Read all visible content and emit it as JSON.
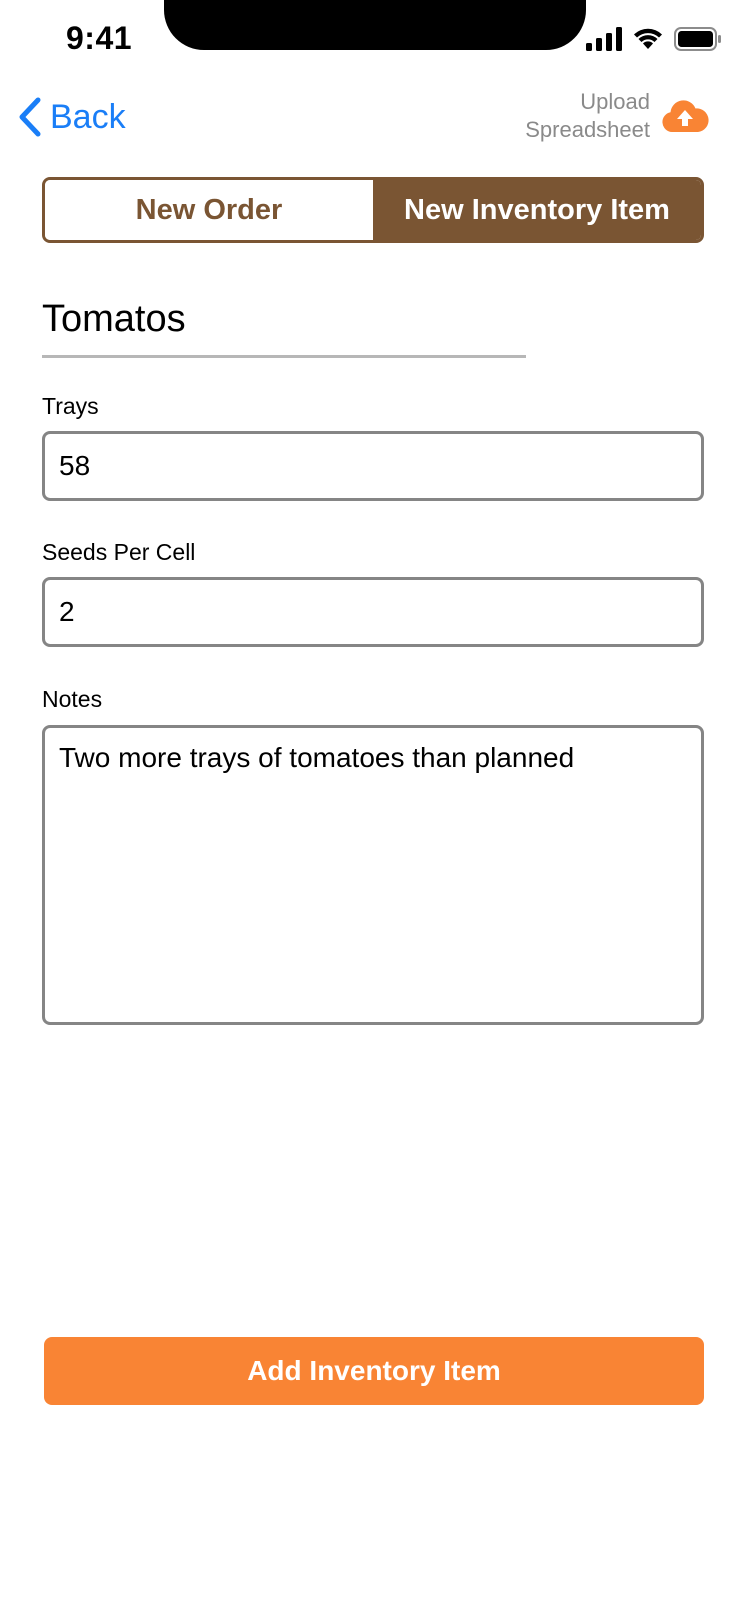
{
  "status_bar": {
    "time": "9:41"
  },
  "nav": {
    "back_label": "Back",
    "upload_label": "Upload Spreadsheet"
  },
  "tabs": [
    {
      "label": "New Order",
      "selected": false
    },
    {
      "label": "New Inventory Item",
      "selected": true
    }
  ],
  "item": {
    "name": "Tomatos"
  },
  "fields": {
    "trays": {
      "label": "Trays",
      "value": "58"
    },
    "seeds_per_cell": {
      "label": "Seeds Per Cell",
      "value": "2"
    },
    "notes": {
      "label": "Notes",
      "value": "Two more trays of tomatoes than planned"
    }
  },
  "actions": {
    "submit_label": "Add Inventory Item"
  },
  "colors": {
    "brand_brown": "#7a5533",
    "accent_orange": "#f98434",
    "link_blue": "#1a7ef7",
    "field_border": "#858585"
  },
  "icons": {
    "back": "chevron-left-icon",
    "upload": "cloud-upload-icon",
    "signal": "cellular-signal-icon",
    "wifi": "wifi-icon",
    "battery": "battery-icon"
  }
}
